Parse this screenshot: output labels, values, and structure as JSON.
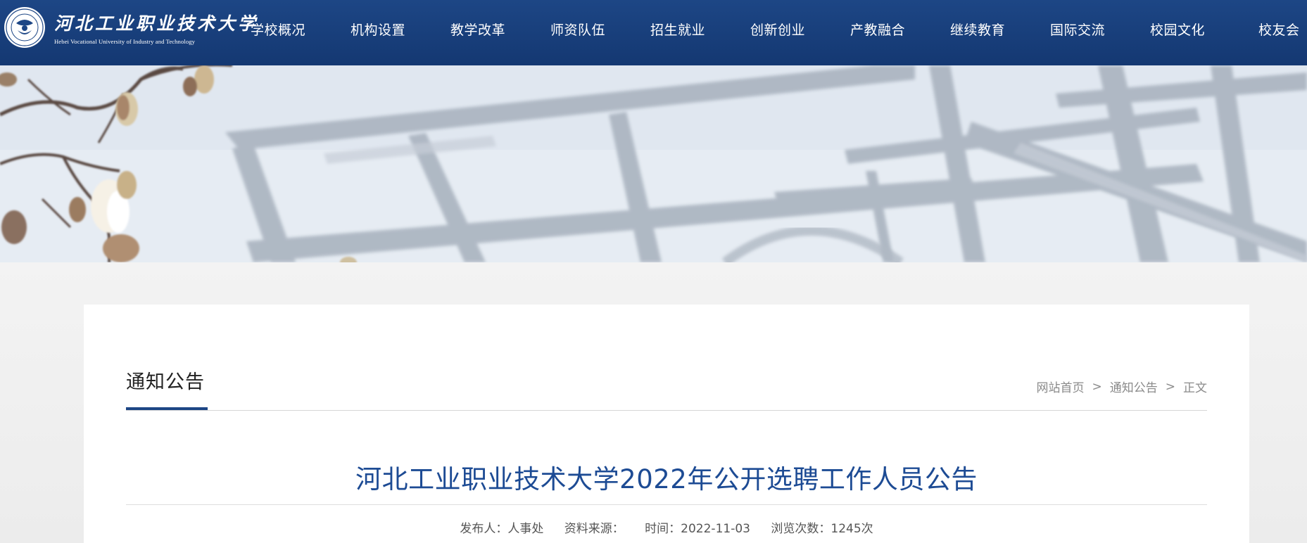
{
  "site": {
    "name_cn": "河北工业职业技术大学",
    "name_en": "Hebei Vocational University of Industry and Technology"
  },
  "nav": {
    "items": [
      "学校概况",
      "机构设置",
      "教学改革",
      "师资队伍",
      "招生就业",
      "创新创业",
      "产教融合",
      "继续教育",
      "国际交流",
      "校园文化",
      "校友会"
    ]
  },
  "section": {
    "title": "通知公告"
  },
  "breadcrumb": {
    "home": "网站首页",
    "sep": ">",
    "category": "通知公告",
    "current": "正文"
  },
  "article": {
    "title": "河北工业职业技术大学2022年公开选聘工作人员公告",
    "publisher": "发布人：人事处",
    "source": "资料来源：",
    "time": "时间：2022-11-03",
    "views": "浏览次数：1245次"
  },
  "colors": {
    "header_bg": "#1d4685",
    "title_blue": "#1d4b94",
    "accent_underline": "#1d4685"
  }
}
